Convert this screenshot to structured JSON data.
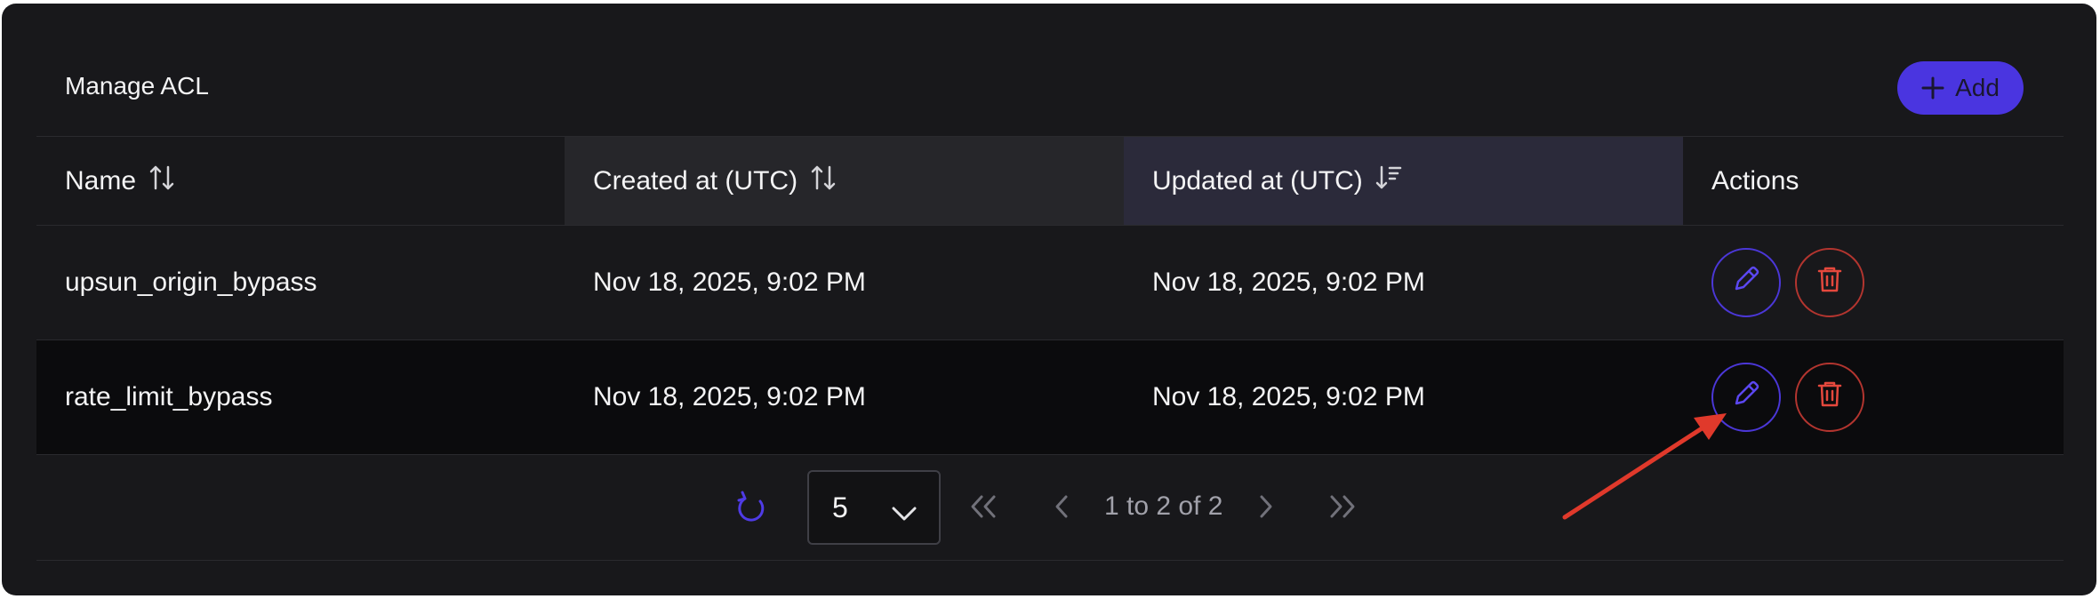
{
  "header": {
    "title": "Manage ACL",
    "add_label": "Add"
  },
  "table": {
    "columns": [
      {
        "label": "Name",
        "sort": "none"
      },
      {
        "label": "Created at (UTC)",
        "sort": "none"
      },
      {
        "label": "Updated at (UTC)",
        "sort": "descending"
      },
      {
        "label": "Actions",
        "sort": ""
      }
    ],
    "rows": [
      {
        "name": "upsun_origin_bypass",
        "created": "Nov 18, 2025, 9:02 PM",
        "updated": "Nov 18, 2025, 9:02 PM"
      },
      {
        "name": "rate_limit_bypass",
        "created": "Nov 18, 2025, 9:02 PM",
        "updated": "Nov 18, 2025, 9:02 PM"
      }
    ],
    "row_actions": [
      "pencil-icon",
      "trash-icon"
    ]
  },
  "pagination": {
    "page_size": "5",
    "info": "1 to 2 of 2"
  },
  "colors": {
    "background": "#18181b",
    "accent": "#4a35e0",
    "danger": "#b3352f",
    "annotation_arrow": "#e0392b"
  }
}
